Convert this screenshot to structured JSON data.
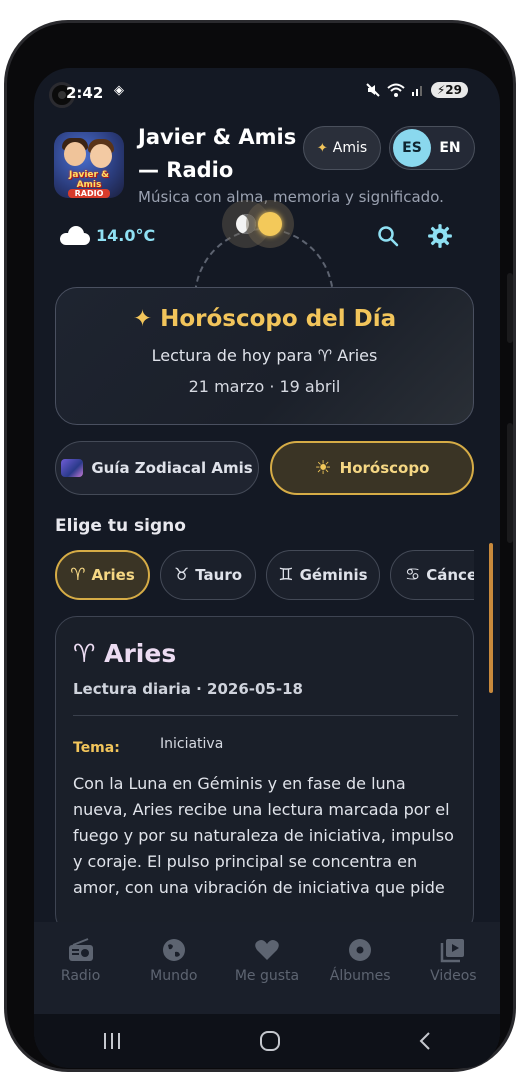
{
  "status": {
    "time": "2:42",
    "battery": "29"
  },
  "header": {
    "title": "Javier & Amis — Radio",
    "tagline": "Música con alma, memoria y significado.",
    "logo_text": "Javier & Amis",
    "logo_sub": "RADIO",
    "amis_label": "Amis",
    "lang_active": "ES",
    "lang_other": "EN"
  },
  "weather": {
    "temp": "14.0°C",
    "icon": "cloud-icon"
  },
  "horoscope_card": {
    "title": "Horóscopo del Día",
    "subtitle": "Lectura de hoy para ♈︎ Aries",
    "date_range": "21 marzo · 19 abril"
  },
  "tabs": {
    "guide": "Guía Zodiacal Amis",
    "horoscope": "Horóscopo"
  },
  "signs": {
    "heading": "Elige tu signo",
    "items": [
      {
        "glyph": "♈︎",
        "label": "Aries"
      },
      {
        "glyph": "♉︎",
        "label": "Tauro"
      },
      {
        "glyph": "♊︎",
        "label": "Géminis"
      },
      {
        "glyph": "♋︎",
        "label": "Cánce"
      }
    ]
  },
  "reading": {
    "title": "♈︎ Aries",
    "subtitle": "Lectura diaria · 2026-05-18",
    "theme_label": "Tema:",
    "theme_value": "Iniciativa",
    "body": "Con la Luna en Géminis y en fase de luna nueva, Aries recibe una lectura marcada por el fuego y por su naturaleza de iniciativa, impulso y coraje. El pulso principal se concentra en amor, con una vibración de iniciativa que pide"
  },
  "nav": [
    {
      "label": "Radio",
      "icon": "radio-icon"
    },
    {
      "label": "Mundo",
      "icon": "globe-icon"
    },
    {
      "label": "Me gusta",
      "icon": "heart-icon"
    },
    {
      "label": "Álbumes",
      "icon": "album-icon"
    },
    {
      "label": "Videos",
      "icon": "video-icon"
    }
  ],
  "colors": {
    "accent": "#f2c55b",
    "cyan": "#8fe0f3",
    "background": "#141924"
  }
}
